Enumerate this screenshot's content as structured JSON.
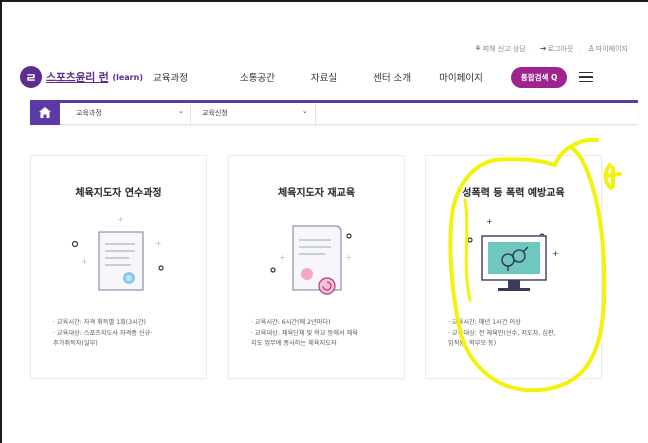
{
  "utility_links": [
    {
      "label": "피해 신고 상담",
      "icon": "report-icon"
    },
    {
      "label": "로그아웃",
      "icon": "logout-icon"
    },
    {
      "label": "마이페이지",
      "icon": "user-icon"
    }
  ],
  "header": {
    "logo_mark": "ㄹ",
    "logo_text": "스포츠윤리 런",
    "logo_sub": "(learn)",
    "nav": [
      "교육과정",
      "소통공간",
      "자료실",
      "센터 소개",
      "마이페이지"
    ],
    "search_label": "통합검색 Q"
  },
  "breadcrumb": {
    "level1": "교육과정",
    "level2": "교육신청"
  },
  "cards": [
    {
      "title": "체육지도자 연수과정",
      "info": [
        "· 교육시간: 자격 취득별 1회(3시간)",
        "· 교육대상: 스포츠지도사 자격증 신규·",
        "추가취득자(일부)"
      ]
    },
    {
      "title": "체육지도자 재교육",
      "info": [
        "· 교육시간: 6시간(매 2년마다)",
        "· 교육대상: 체육단체 및 학교 등에서 체육",
        "지도 업무에 종사하는 체육지도자"
      ]
    },
    {
      "title": "성폭력 등 폭력 예방교육",
      "info": [
        "· 교육시간: 매년 1시간 이상",
        "· 교육대상: 전 체육인(선수, 지도자, 심판,",
        "임직원, 학부모 등)"
      ]
    }
  ],
  "colors": {
    "brand": "#5b2d8e",
    "accent": "#a0248f",
    "bar": "#5b3aa7",
    "highlight": "#f2f20a"
  }
}
